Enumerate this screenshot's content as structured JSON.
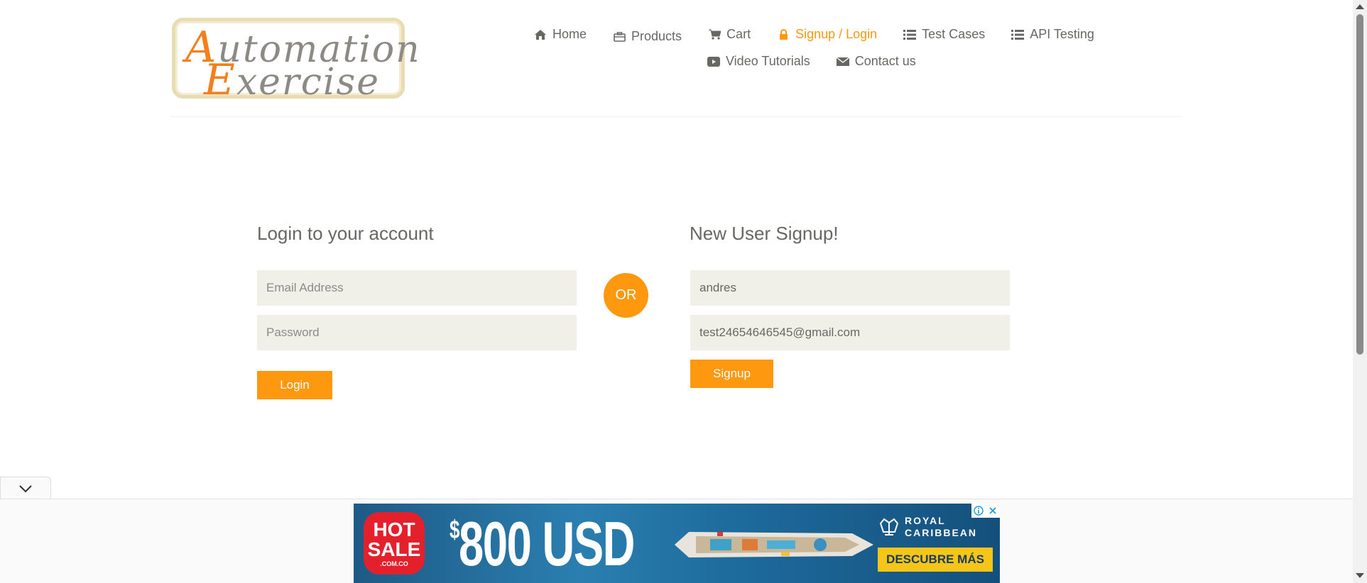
{
  "logo": {
    "line1_cap": "A",
    "line1_rest": "utomation",
    "line2_cap": "E",
    "line2_rest": "xercise"
  },
  "nav": {
    "row1": [
      {
        "label": "Home",
        "icon": "home-icon"
      },
      {
        "label": "Products",
        "icon": "products-icon"
      },
      {
        "label": "Cart",
        "icon": "cart-icon"
      },
      {
        "label": "Signup / Login",
        "icon": "lock-icon",
        "active": true
      },
      {
        "label": "Test Cases",
        "icon": "list-icon"
      },
      {
        "label": "API Testing",
        "icon": "list-icon"
      }
    ],
    "row2": [
      {
        "label": "Video Tutorials",
        "icon": "youtube-icon"
      },
      {
        "label": "Contact us",
        "icon": "envelope-icon"
      }
    ]
  },
  "login": {
    "title": "Login to your account",
    "email_placeholder": "Email Address",
    "password_placeholder": "Password",
    "button": "Login"
  },
  "or_label": "OR",
  "signup": {
    "title": "New User Signup!",
    "name_value": "andres",
    "email_value": "test24654646545@gmail.com",
    "button": "Signup"
  },
  "ad": {
    "hot_sale_1": "HOT",
    "hot_sale_2": "SALE",
    "hot_sale_3": ".COM.CO",
    "price_symbol": "$",
    "price": "800",
    "currency": "USD",
    "brand_line1": "ROYAL",
    "brand_line2": "CARIBBEAN",
    "cta": "DESCUBRE MÁS"
  },
  "colors": {
    "accent": "#fe980f",
    "text": "#696763",
    "field_bg": "#f0f0e9"
  }
}
